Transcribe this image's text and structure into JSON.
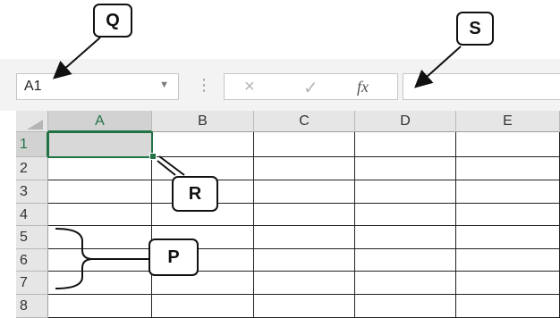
{
  "formula_bar": {
    "name_box_value": "A1",
    "dropdown_icon": "caret-down-icon",
    "separator_icon": "vertical-dots-icon",
    "cancel_icon": "×",
    "enter_icon": "✓",
    "function_label": "fx",
    "formula_value": ""
  },
  "columns": [
    "A",
    "B",
    "C",
    "D",
    "E"
  ],
  "rows": [
    "1",
    "2",
    "3",
    "4",
    "5",
    "6",
    "7",
    "8"
  ],
  "selected_cell": "A1",
  "callouts": {
    "q": "Q",
    "s": "S",
    "r": "R",
    "p": "P"
  },
  "colors": {
    "accent": "#217346",
    "header_bg": "#e6e6e6",
    "selection_bg": "#d8d8d8"
  }
}
